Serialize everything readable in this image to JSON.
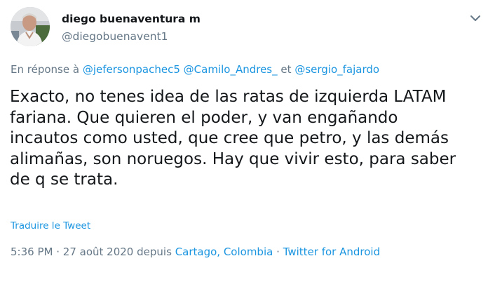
{
  "author": {
    "display_name": "diego buenaventura m",
    "handle": "@diegobuenavent1"
  },
  "reply": {
    "prefix": "En réponse à",
    "mentions": [
      "@jefersonpachec5",
      "@Camilo_Andres_",
      "@sergio_fajardo"
    ],
    "conjunction": "et"
  },
  "tweet": {
    "lines": [
      "Exacto, no tenes idea de las ratas de izquierda LATAM",
      "fariana. Que quieren el poder, y van engañando",
      "incautos como usted, que cree que petro, y las demás",
      "alimañas, son noruegos. Hay que vivir esto, para saber",
      "de q se trata."
    ],
    "translate_label": "Traduire le Tweet"
  },
  "meta": {
    "time": "5:36 PM",
    "dot1": "·",
    "date": "27 août 2020",
    "via": "depuis",
    "location": "Cartago, Colombia",
    "dot2": "·",
    "source": "Twitter for Android"
  },
  "icons": {
    "caret": "chevron-down-icon",
    "avatar": "profile-photo"
  },
  "colors": {
    "link": "#1b95e0",
    "secondary": "#657786",
    "text": "#14171a"
  }
}
